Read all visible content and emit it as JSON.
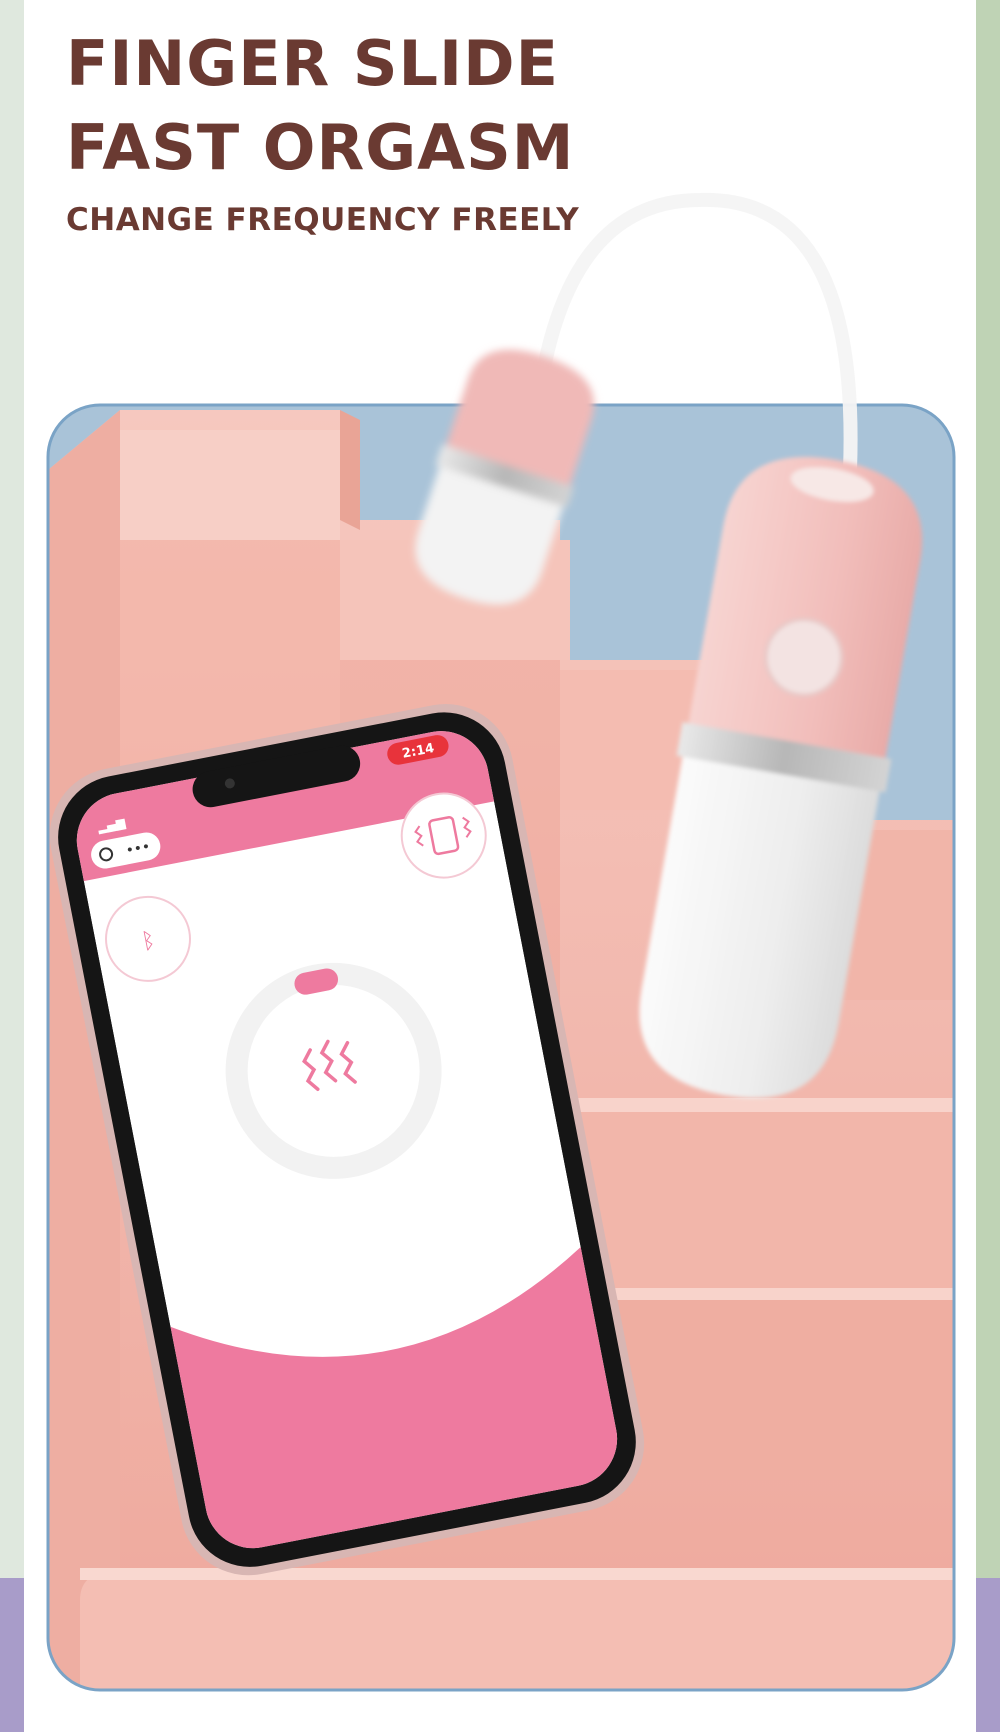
{
  "headline": {
    "line1": "FINGER SLIDE",
    "line2": "FAST ORGASM",
    "subtitle": "CHANGE FREQUENCY FREELY"
  },
  "phone": {
    "status_time": "2:14",
    "icons": [
      "bluetooth-icon",
      "vibrate-phone-icon",
      "vibration-wave-icon",
      "menu-dots-icon",
      "close-circle-icon"
    ]
  },
  "colors": {
    "title_brown": "#6a3a32",
    "app_pink": "#ee7a9f",
    "product_pink": "#f2bfbd",
    "sky_blue": "#a7c2d8",
    "stair_pink": "#f3b7ad",
    "frame_blue": "#7aa3c6",
    "band_purple": "#a89cc9",
    "side_green": "#bfd3b5"
  }
}
